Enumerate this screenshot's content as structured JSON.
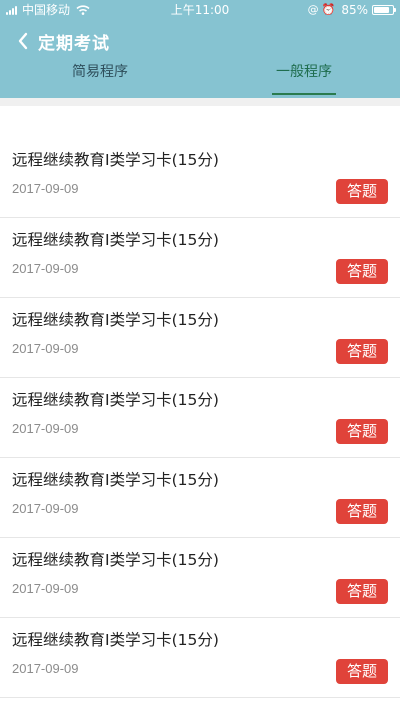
{
  "status_bar": {
    "carrier": "中国移动",
    "time": "上午11:00",
    "battery_text": "85%",
    "battery_level": 0.85,
    "icons": [
      "signal-icon",
      "wifi-icon",
      "lock-rotation-icon",
      "alarm-icon",
      "battery-icon"
    ]
  },
  "header": {
    "title": "定期考试",
    "back_icon": "chevron-left-icon",
    "background_color": "#86c3d1"
  },
  "tabs": [
    {
      "label": "简易程序",
      "selected": false
    },
    {
      "label": "一般程序",
      "selected": true
    }
  ],
  "items": [
    {
      "title": "远程继续教育I类学习卡(15分)",
      "date": "2017-09-09",
      "button": "答题"
    },
    {
      "title": "远程继续教育I类学习卡(15分)",
      "date": "2017-09-09",
      "button": "答题"
    },
    {
      "title": "远程继续教育I类学习卡(15分)",
      "date": "2017-09-09",
      "button": "答题"
    },
    {
      "title": "远程继续教育I类学习卡(15分)",
      "date": "2017-09-09",
      "button": "答题"
    },
    {
      "title": "远程继续教育I类学习卡(15分)",
      "date": "2017-09-09",
      "button": "答题"
    },
    {
      "title": "远程继续教育I类学习卡(15分)",
      "date": "2017-09-09",
      "button": "答题"
    },
    {
      "title": "远程继续教育I类学习卡(15分)",
      "date": "2017-09-09",
      "button": "答题"
    }
  ],
  "colors": {
    "accent_tab": "#2a7b4e",
    "answer_button": "#e0433a"
  }
}
